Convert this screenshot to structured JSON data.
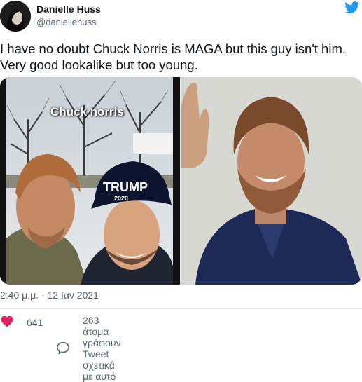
{
  "author": {
    "name": "Danielle Huss",
    "handle": "@daniellehuss"
  },
  "tweet": {
    "text_line1": "I have no doubt Chuck Norris is MAGA but this guy isn't him.",
    "text_line2": "Very good lookalike but too young."
  },
  "media": {
    "left_overlay_text": "Chuck norris",
    "hat_text": "TRUMP",
    "hat_year": "2020"
  },
  "meta": {
    "timestamp": "2:40 μ.μ. · 12 Ιαν 2021"
  },
  "actions": {
    "likes": "641",
    "replies_text": "263 άτομα γράφουν Tweet σχετικά με αυτό"
  },
  "colors": {
    "accent": "#1d9bf0",
    "like_red": "#e0245e",
    "secondary_text": "#536471"
  },
  "icons": [
    "twitter-bird-icon",
    "heart-icon",
    "reply-bubble-icon"
  ]
}
